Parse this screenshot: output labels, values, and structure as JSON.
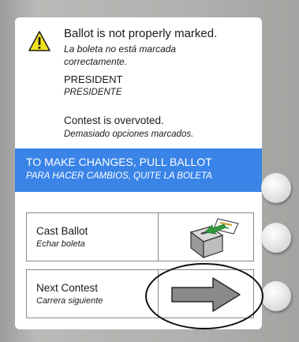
{
  "alert": {
    "title": "Ballot is not properly marked.",
    "title_es_line1": "La boleta no está marcada",
    "title_es_line2": "correctamente.",
    "contest": "PRESIDENT",
    "contest_es": "PRESIDENTE",
    "status": "Contest is overvoted.",
    "status_es": "Demasiado opciones marcados."
  },
  "banner": {
    "text": "TO MAKE CHANGES, PULL BALLOT",
    "text_es": "PARA HACER CAMBIOS, QUITE LA BOLETA"
  },
  "options": {
    "cast": {
      "label": "Cast Ballot",
      "label_es": "Echar boleta",
      "icon": "ballot-box-icon"
    },
    "next": {
      "label": "Next Contest",
      "label_es": "Carrera siguiente",
      "icon": "arrow-right-icon"
    }
  },
  "colors": {
    "banner": "#3a84e8",
    "warning": "#f2e21b",
    "ballot_arrow": "#2f9a3a",
    "next_arrow": "#8a8a8a"
  }
}
